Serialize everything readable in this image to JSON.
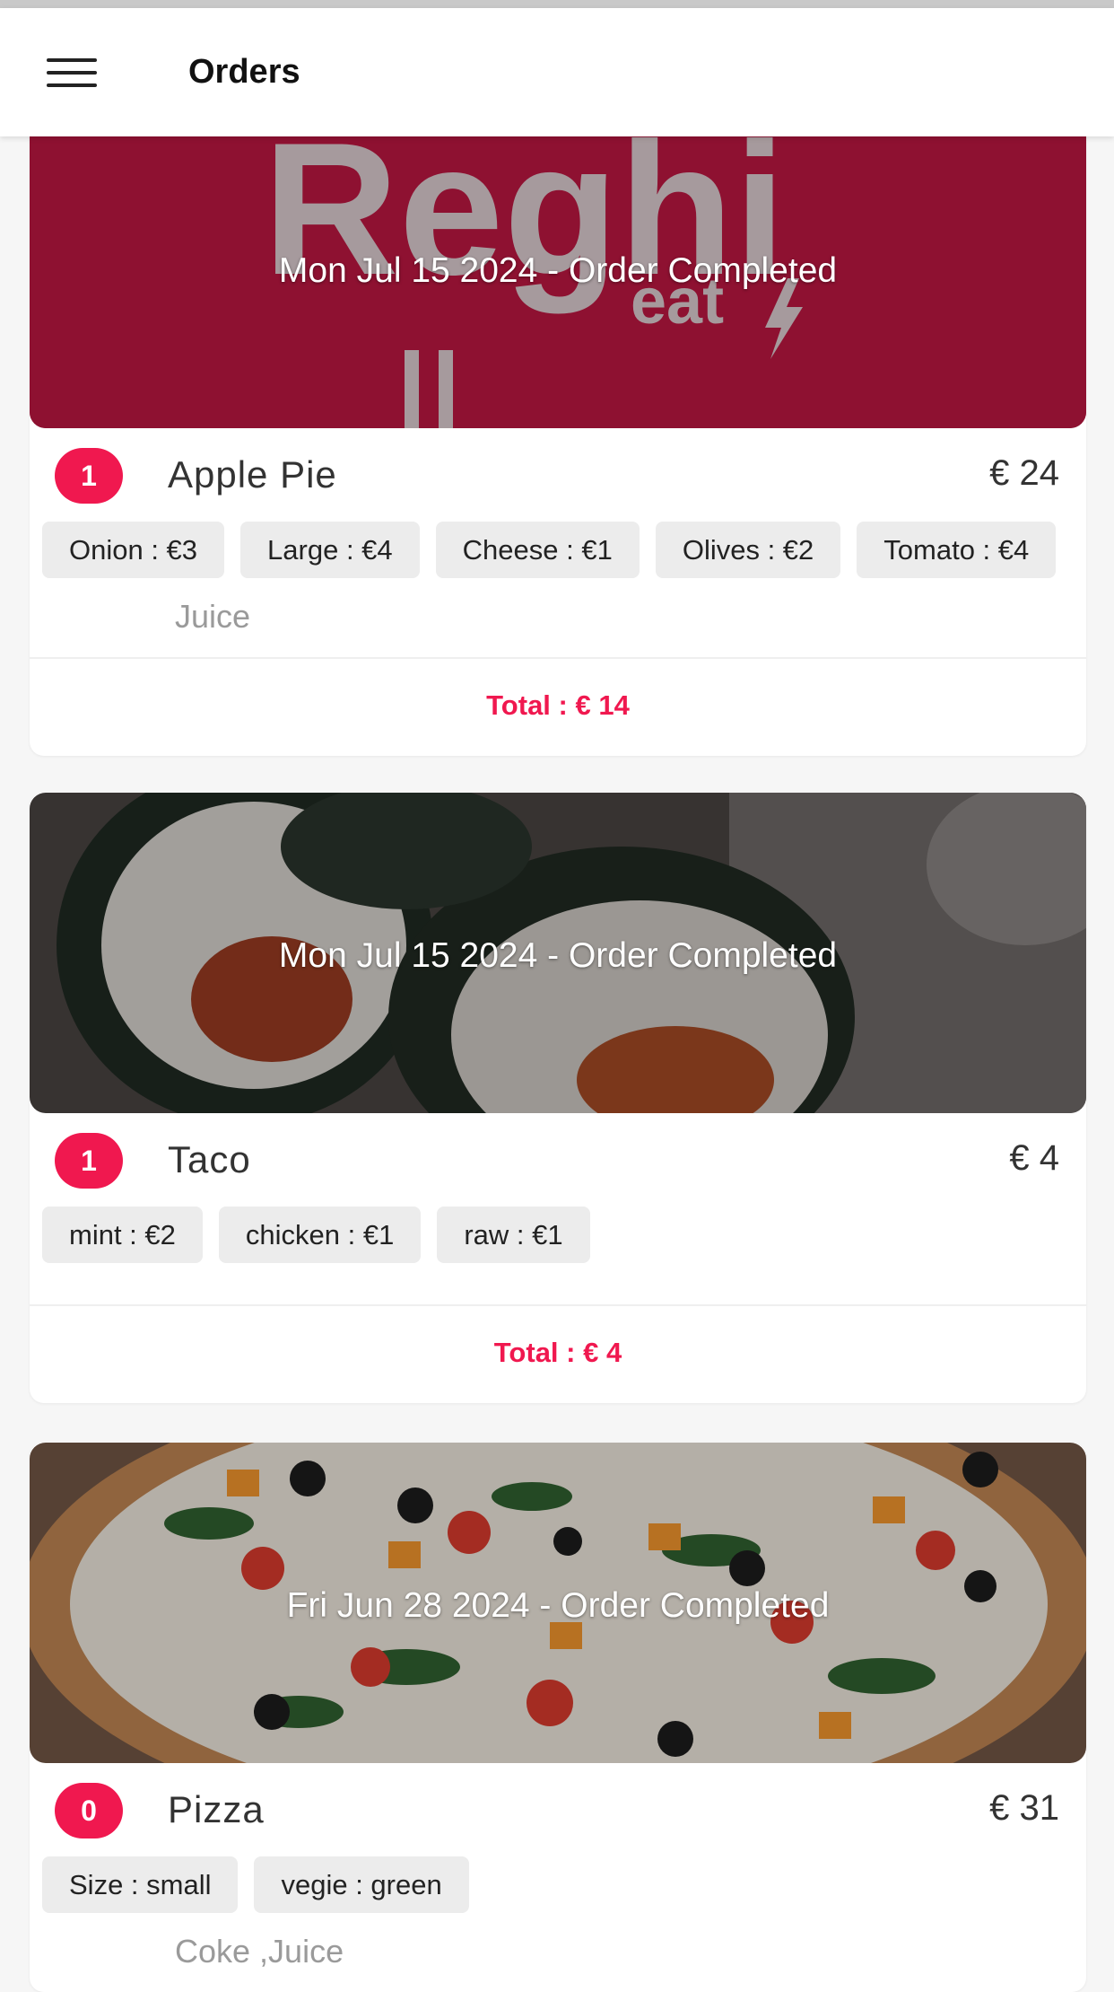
{
  "app_bar": {
    "title": "Orders"
  },
  "brand": {
    "logo_word": "Reghi",
    "logo_sub": "eat"
  },
  "orders": [
    {
      "banner_text": "Mon Jul 15 2024 - Order Completed",
      "item": {
        "qty": "1",
        "name": "Apple Pie",
        "price": "€ 24"
      },
      "options": [
        "Onion : €3",
        "Large : €4",
        "Cheese : €1",
        "Olives : €2",
        "Tomato : €4"
      ],
      "extras": "Juice",
      "total": "Total : € 14"
    },
    {
      "banner_text": "Mon Jul 15 2024 - Order Completed",
      "item": {
        "qty": "1",
        "name": "Taco",
        "price": "€ 4"
      },
      "options": [
        "mint : €2",
        "chicken : €1",
        "raw : €1"
      ],
      "total": "Total : € 4"
    },
    {
      "banner_text": "Fri Jun 28 2024 - Order Completed",
      "item": {
        "qty": "0",
        "name": "Pizza",
        "price": "€ 31"
      },
      "options": [
        "Size : small",
        "vegie : green"
      ],
      "extras": "Coke ,Juice"
    }
  ],
  "colors": {
    "accent": "#f0184f",
    "brand_banner": "#8e1131"
  }
}
